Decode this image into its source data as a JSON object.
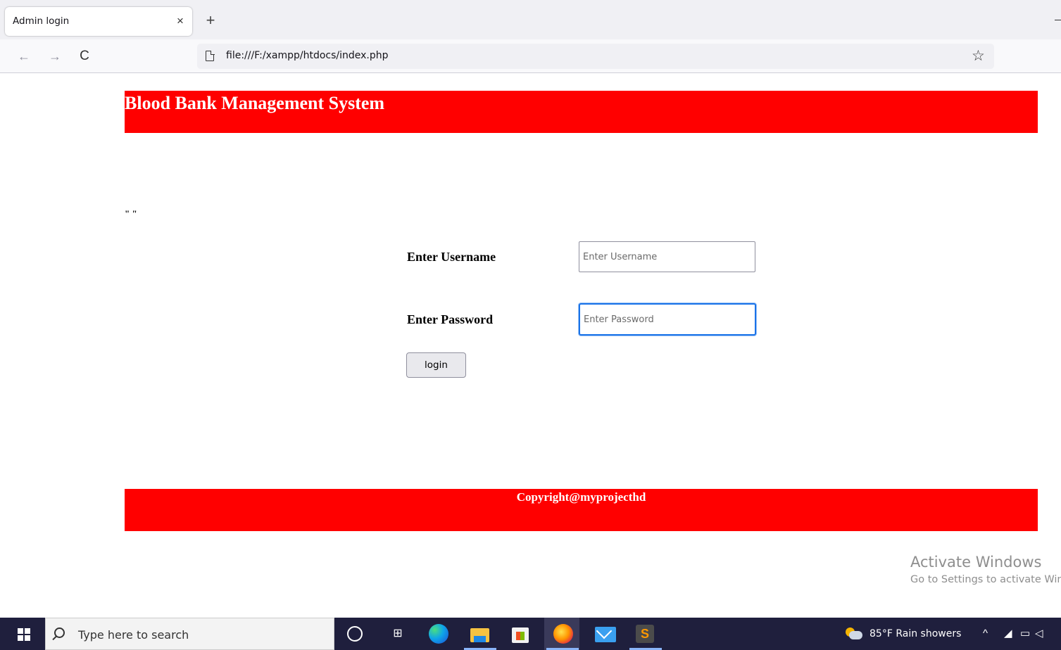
{
  "browser": {
    "tab_title": "Admin login",
    "tab_close": "×",
    "new_tab": "+",
    "back": "←",
    "forward": "→",
    "reload": "C",
    "url": "file:///F:/xampp/htdocs/index.php",
    "bookmark_star": "☆"
  },
  "page": {
    "header_title": "Blood Bank Management System",
    "stray_text": "\" \"",
    "username_label": "Enter Username",
    "username_placeholder": "Enter Username",
    "username_value": "",
    "password_label": "Enter Password",
    "password_placeholder": "Enter Password",
    "password_value": "",
    "login_button": "login",
    "footer_text": "Copyright@myprojecthd",
    "accent_color": "#ff0000"
  },
  "watermark": {
    "line1": "Activate Windows",
    "line2": "Go to Settings to activate Windows."
  },
  "taskbar": {
    "search_placeholder": "Type here to search",
    "weather": "85°F  Rain showers",
    "tray_chevron": "^",
    "icons": [
      "windows-start-icon",
      "search-icon",
      "cortana-icon",
      "task-view-icon",
      "edge-icon",
      "file-explorer-icon",
      "store-icon",
      "firefox-icon",
      "mail-icon",
      "sublime-text-icon",
      "weather-icon",
      "network-icon",
      "battery-icon",
      "volume-icon"
    ]
  }
}
